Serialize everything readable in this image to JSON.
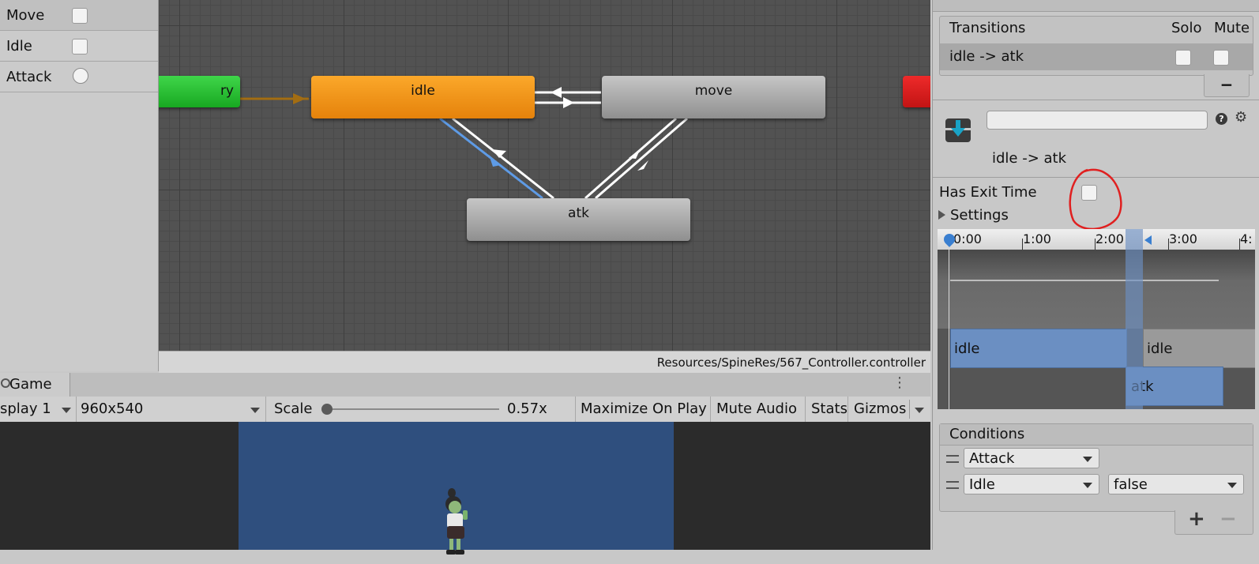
{
  "parameters": [
    {
      "name": "Move",
      "type": "bool"
    },
    {
      "name": "Idle",
      "type": "bool"
    },
    {
      "name": "Attack",
      "type": "trigger"
    }
  ],
  "graph": {
    "entry_label": "ry",
    "states": {
      "idle": "idle",
      "move": "move",
      "atk": "atk"
    },
    "path": "Resources/SpineRes/567_Controller.controller"
  },
  "game": {
    "tab_label": "Game",
    "display": "splay 1",
    "resolution": "960x540",
    "scale_label": "Scale",
    "scale_value": "0.57x",
    "scale_fraction": 0.0,
    "maximize": "Maximize On Play",
    "mute": "Mute Audio",
    "stats": "Stats",
    "gizmos": "Gizmos"
  },
  "inspector": {
    "transitions_header": "Transitions",
    "solo_label": "Solo",
    "mute_label": "Mute",
    "transition_row": "idle -> atk",
    "remove_symbol": "−",
    "name_field_value": "",
    "transition_title": "idle -> atk",
    "has_exit_time_label": "Has Exit Time",
    "settings_label": "Settings",
    "timeline": {
      "ticks": [
        "0:00",
        "1:00",
        "2:00",
        "3:00",
        "4:"
      ],
      "source_clip": "idle",
      "dest_clip": "atk",
      "next_clip": "idle"
    },
    "conditions_header": "Conditions",
    "conditions": [
      {
        "param": "Attack",
        "value": ""
      },
      {
        "param": "Idle",
        "value": "false"
      }
    ],
    "add_symbol": "+",
    "minus_symbol": "−"
  },
  "colors": {
    "idle_state": "#f0920f",
    "entry_state": "#1fbf2a",
    "any_state": "#d21a1a",
    "annotation": "#e02020",
    "timeline_blue": "#6b8fc2"
  }
}
